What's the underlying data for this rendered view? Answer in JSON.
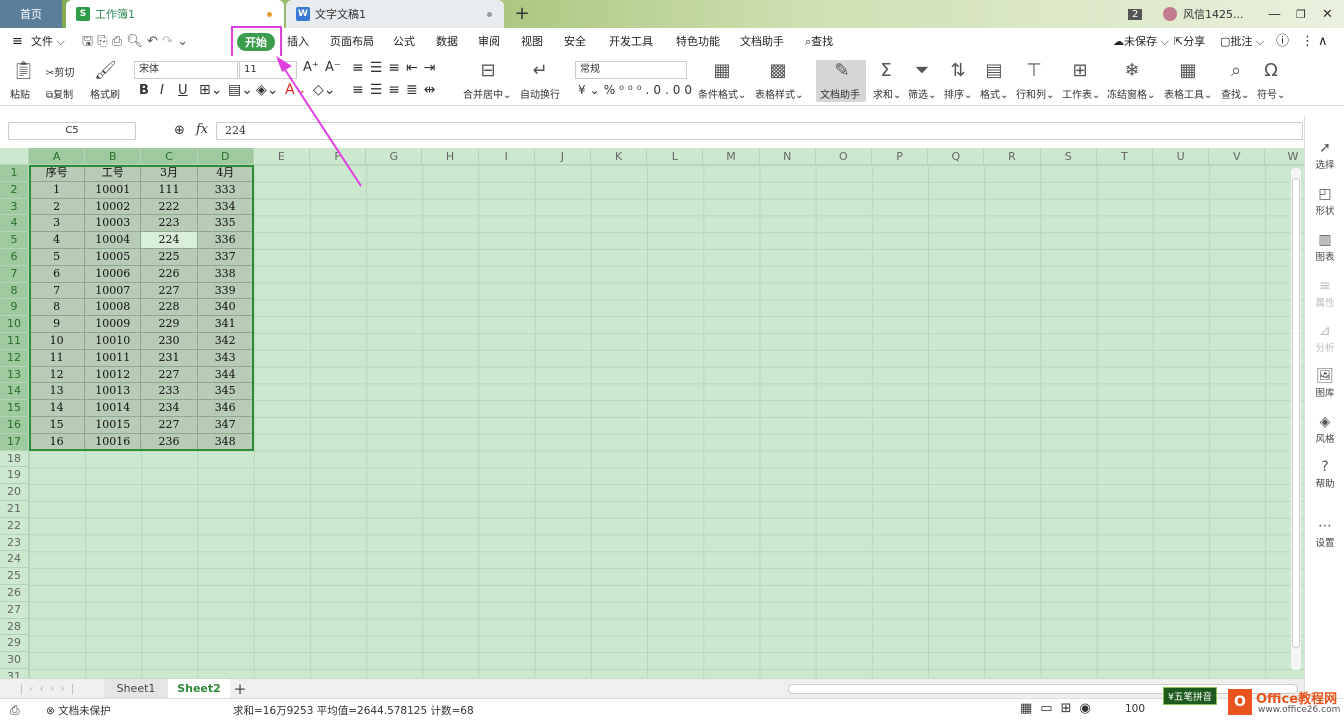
{
  "tabs": {
    "home": "首页",
    "workbook": "工作簿1",
    "document": "文字文稿1",
    "add": "+",
    "badge": "2",
    "user": "风信1425..."
  },
  "menu": {
    "file": "文件",
    "start": "开始",
    "items": [
      "插入",
      "页面布局",
      "公式",
      "数据",
      "审阅",
      "视图",
      "安全",
      "开发工具",
      "特色功能",
      "文档助手",
      "查找"
    ],
    "unsaved": "未保存",
    "share": "分享",
    "comment": "批注"
  },
  "ribbon": {
    "paste": "粘贴",
    "cut": "剪切",
    "copy": "复制",
    "format_painter": "格式刷",
    "font": "宋体",
    "font_size": "11",
    "merge": "合并居中",
    "wrap": "自动换行",
    "number_format": "常规",
    "cond_format": "条件格式",
    "table_style": "表格样式",
    "doc_helper": "文档助手",
    "sum": "求和",
    "filter": "筛选",
    "sort": "排序",
    "format": "格式",
    "row_col": "行和列",
    "worksheet": "工作表",
    "freeze": "冻结窗格",
    "table_tools": "表格工具",
    "find": "查找",
    "symbol": "符号"
  },
  "formula": {
    "cell_ref": "C5",
    "value": "224"
  },
  "columns": [
    "A",
    "B",
    "C",
    "D",
    "E",
    "F",
    "G",
    "H",
    "I",
    "J",
    "K",
    "L",
    "M",
    "N",
    "O",
    "P",
    "Q",
    "R",
    "S",
    "T",
    "U",
    "V",
    "W"
  ],
  "rows": [
    "1",
    "2",
    "3",
    "4",
    "5",
    "6",
    "7",
    "8",
    "9",
    "10",
    "11",
    "12",
    "13",
    "14",
    "15",
    "16",
    "17",
    "18",
    "19",
    "20",
    "21",
    "22",
    "23",
    "24",
    "25",
    "26",
    "27",
    "28",
    "29",
    "30",
    "31"
  ],
  "table": {
    "headers": [
      "序号",
      "工号",
      "3月",
      "4月"
    ],
    "rows": [
      [
        "1",
        "10001",
        "111",
        "333"
      ],
      [
        "2",
        "10002",
        "222",
        "334"
      ],
      [
        "3",
        "10003",
        "223",
        "335"
      ],
      [
        "4",
        "10004",
        "224",
        "336"
      ],
      [
        "5",
        "10005",
        "225",
        "337"
      ],
      [
        "6",
        "10006",
        "226",
        "338"
      ],
      [
        "7",
        "10007",
        "227",
        "339"
      ],
      [
        "8",
        "10008",
        "228",
        "340"
      ],
      [
        "9",
        "10009",
        "229",
        "341"
      ],
      [
        "10",
        "10010",
        "230",
        "342"
      ],
      [
        "11",
        "10011",
        "231",
        "343"
      ],
      [
        "12",
        "10012",
        "227",
        "344"
      ],
      [
        "13",
        "10013",
        "233",
        "345"
      ],
      [
        "14",
        "10014",
        "234",
        "346"
      ],
      [
        "15",
        "10015",
        "227",
        "347"
      ],
      [
        "16",
        "10016",
        "236",
        "348"
      ]
    ]
  },
  "right_panel": [
    "选择",
    "形状",
    "图表",
    "属性",
    "分析",
    "图库",
    "风格",
    "帮助",
    "设置"
  ],
  "sheets": [
    "Sheet1",
    "Sheet2"
  ],
  "status": {
    "protect": "文档未保护",
    "stats": "求和=16万9253  平均值=2644.578125  计数=68",
    "zoom": "100",
    "ime": "五笔拼音",
    "watermark_brand": "Office教程网",
    "watermark_url": "www.office26.com"
  },
  "colors": {
    "accent": "#3c9d4c",
    "highlight": "#e040e0",
    "sheet_bg": "#cce8cf"
  }
}
